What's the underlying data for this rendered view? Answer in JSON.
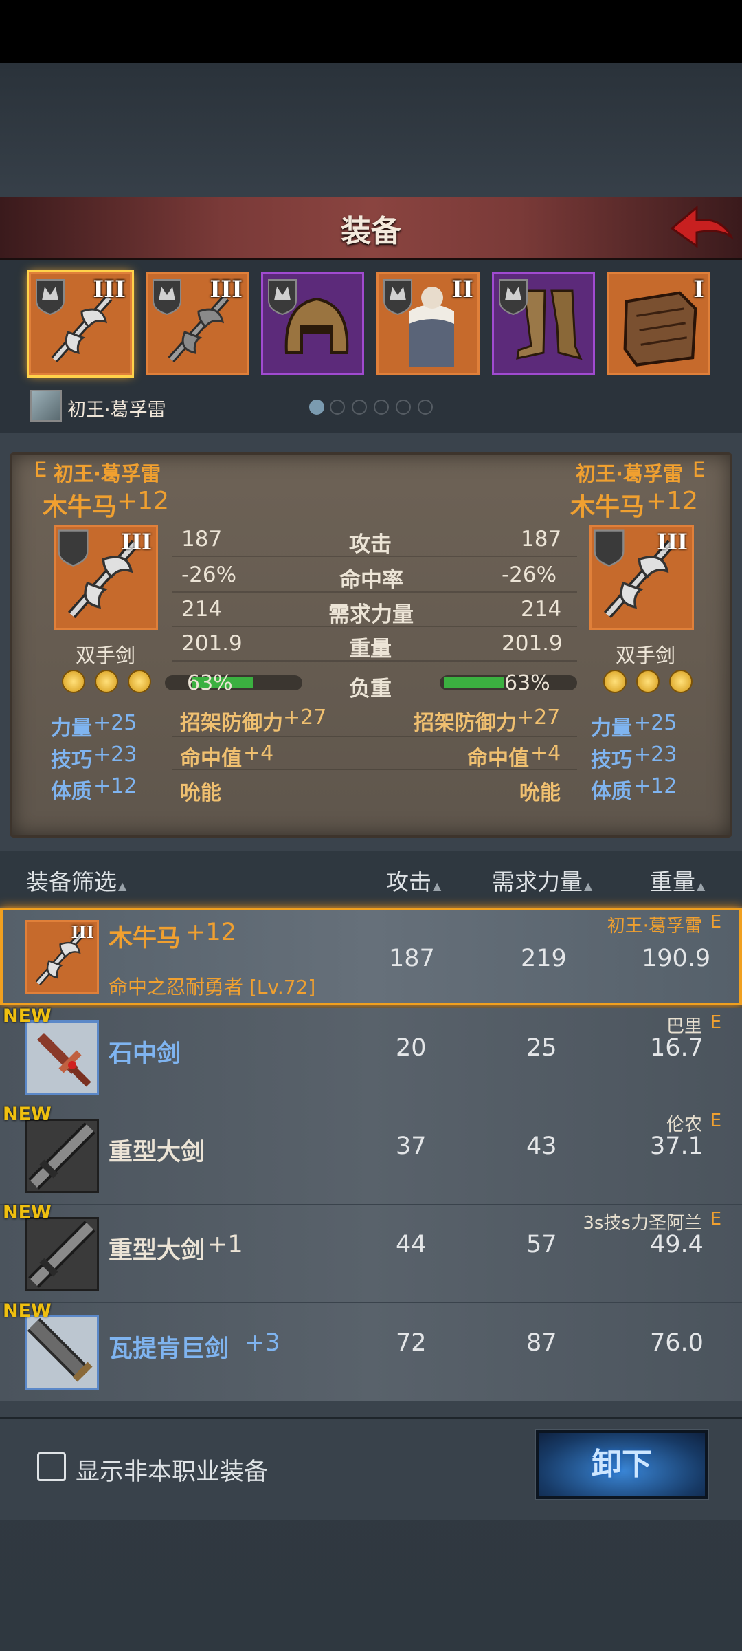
{
  "title": "装备",
  "character": {
    "name": "初王·葛孚雷"
  },
  "slots": [
    {
      "tier": "III",
      "icon": "halberd-icon",
      "rarity": "orange",
      "selected": true
    },
    {
      "tier": "III",
      "icon": "halberd-icon",
      "rarity": "orange"
    },
    {
      "tier": "",
      "icon": "helmet-icon",
      "rarity": "purple"
    },
    {
      "tier": "II",
      "icon": "armor-icon",
      "rarity": "orange"
    },
    {
      "tier": "",
      "icon": "greaves-icon",
      "rarity": "purple"
    },
    {
      "tier": "I",
      "icon": "book-icon",
      "rarity": "orange"
    }
  ],
  "page_dots": {
    "total": 6,
    "active": 1
  },
  "compare": {
    "left": {
      "grade": "E",
      "owner": "初王·葛孚雷",
      "name": "木牛马",
      "plus": "+12",
      "tier": "III",
      "type": "双手剑",
      "attack": "187",
      "accuracy": "-26%",
      "strength": "214",
      "weight": "201.9",
      "load": "63%",
      "load_fraction": 0.63,
      "stats": [
        {
          "name": "力量",
          "v": "+25"
        },
        {
          "name": "技巧",
          "v": "+23"
        },
        {
          "name": "体质",
          "v": "+12"
        }
      ],
      "parry": "招架防御力",
      "parry_v": "+27",
      "hit": "命中值",
      "hit_v": "+4",
      "roar": "吮能"
    },
    "right": {
      "grade": "E",
      "owner": "初王·葛孚雷",
      "name": "木牛马",
      "plus": "+12",
      "tier": "III",
      "type": "双手剑",
      "attack": "187",
      "accuracy": "-26%",
      "strength": "214",
      "weight": "201.9",
      "load": "63%",
      "load_fraction": 0.63,
      "stats": [
        {
          "name": "力量",
          "v": "+25"
        },
        {
          "name": "技巧",
          "v": "+23"
        },
        {
          "name": "体质",
          "v": "+12"
        }
      ],
      "parry": "招架防御力",
      "parry_v": "+27",
      "hit": "命中值",
      "hit_v": "+4",
      "roar": "吮能"
    },
    "labels": {
      "attack": "攻击",
      "accuracy": "命中率",
      "strength": "需求力量",
      "weight": "重量",
      "load": "负重"
    }
  },
  "list_headers": {
    "filter": "装备筛选",
    "attack": "攻击",
    "strength": "需求力量",
    "weight": "重量"
  },
  "items": [
    {
      "name": "木牛马",
      "plus": "+12",
      "sub": "命中之忍耐勇者 [Lv.72]",
      "attack": "187",
      "strength": "219",
      "weight": "190.9",
      "owner": "初王·葛孚雷",
      "grade": "E",
      "new": "",
      "tier": "III",
      "selected": true
    },
    {
      "name": "石中剑",
      "plus": "",
      "sub": "",
      "attack": "20",
      "strength": "25",
      "weight": "16.7",
      "owner": "巴里",
      "grade": "E",
      "new": "NEW",
      "tier": ""
    },
    {
      "name": "重型大剑",
      "plus": "",
      "sub": "",
      "attack": "37",
      "strength": "43",
      "weight": "37.1",
      "owner": "伦农",
      "grade": "E",
      "new": "NEW",
      "tier": ""
    },
    {
      "name": "重型大剑",
      "plus": "+1",
      "sub": "",
      "attack": "44",
      "strength": "57",
      "weight": "49.4",
      "owner": "3s技s力圣阿兰",
      "grade": "E",
      "new": "NEW",
      "tier": ""
    },
    {
      "name": "瓦提肯巨剑",
      "plus": "+3",
      "sub": "",
      "attack": "72",
      "strength": "87",
      "weight": "76.0",
      "owner": "",
      "grade": "",
      "new": "NEW",
      "tier": ""
    }
  ],
  "bottom": {
    "checkbox_label": "显示非本职业装备",
    "checked": false,
    "unequip": "卸下"
  }
}
